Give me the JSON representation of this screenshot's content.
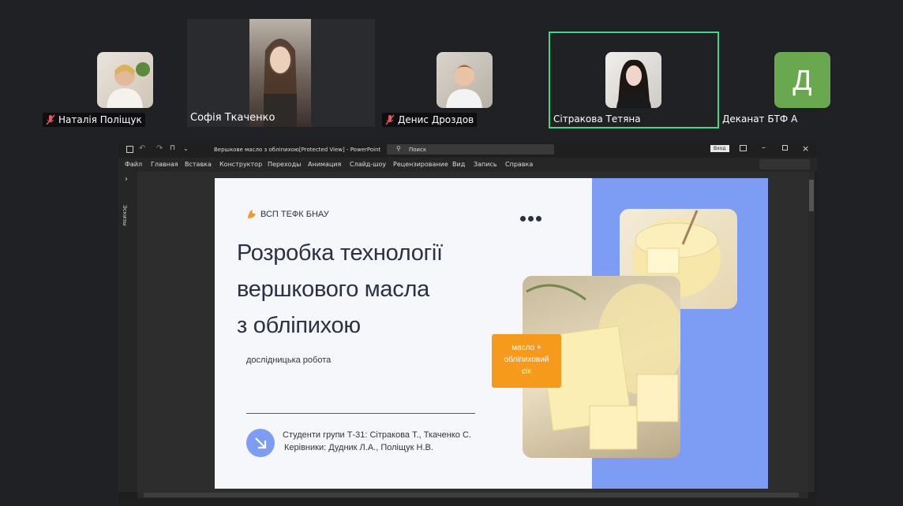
{
  "participants": [
    {
      "name": "Наталія Поліщук",
      "muted": true
    },
    {
      "name": "Софія Ткаченко",
      "muted": false
    },
    {
      "name": "Денис Дроздов",
      "muted": true
    },
    {
      "name": "Сітракова Тетяна",
      "muted": false,
      "speaking": true
    },
    {
      "name": "Деканат БТФ А",
      "muted": false,
      "initial": "Д"
    }
  ],
  "colors": {
    "speaking_border": "#3ddc84",
    "initial_avatar": "#6aa84f",
    "slide_blue": "#7d9cf4",
    "badge_orange": "#f59a1b"
  },
  "ppt": {
    "title": "Вершкове масло з обліпихою[Protected View] - PowerPoint",
    "search_placeholder": "Поиск",
    "signin": "Вход",
    "menu": [
      "Файл",
      "Главная",
      "Вставка",
      "Конструктор",
      "Переходы",
      "Анимация",
      "Слайд-шоу",
      "Рецензирование",
      "Вид",
      "Запись",
      "Справка"
    ],
    "side_panel_label": "Эскизы"
  },
  "slide": {
    "brand": "ВСП ТЕФК БНАУ",
    "title_lines": [
      "Розробка технології",
      "вершкового масла",
      "з обліпихою"
    ],
    "subtitle": "дослідницька робота",
    "badge": [
      "масло +",
      "обліпиховий",
      "сік"
    ],
    "authors": [
      "Студенти групи Т-31: Сітракова Т., Ткаченко С.",
      "Керівники: Дудник Л.А., Поліщук Н.В."
    ]
  }
}
